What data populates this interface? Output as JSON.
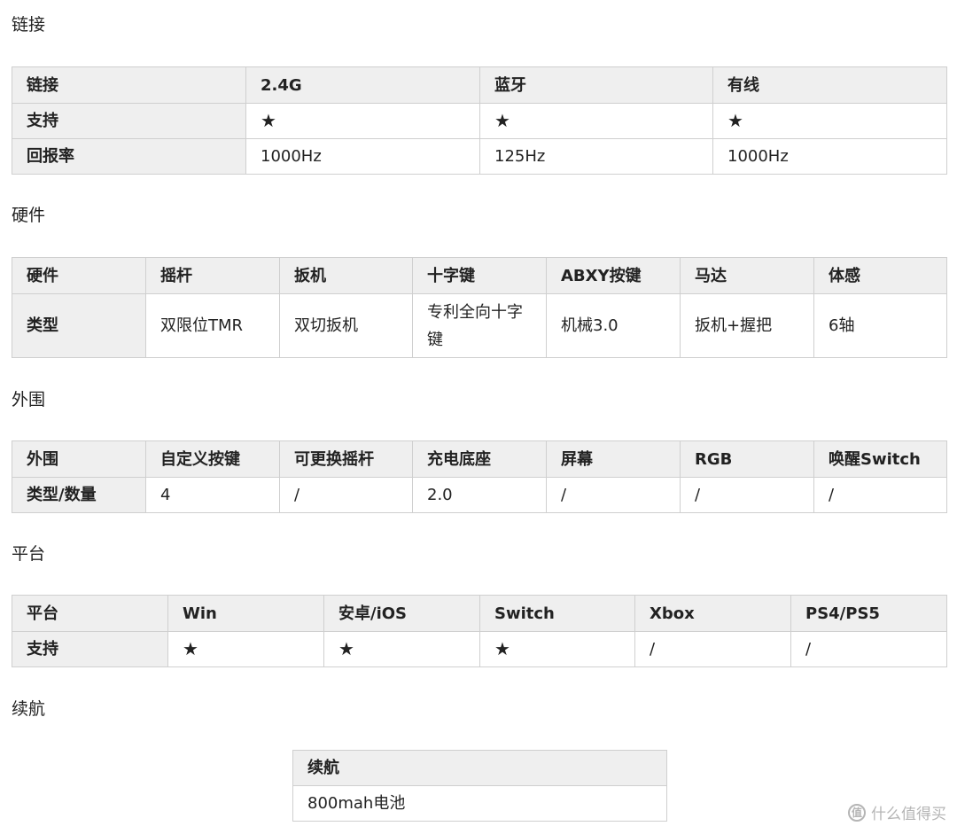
{
  "sections": {
    "link": {
      "title": "链接",
      "header": [
        "链接",
        "2.4G",
        "蓝牙",
        "有线"
      ],
      "rows": [
        [
          "支持",
          "★",
          "★",
          "★"
        ],
        [
          "回报率",
          "1000Hz",
          "125Hz",
          "1000Hz"
        ]
      ]
    },
    "hardware": {
      "title": "硬件",
      "header": [
        "硬件",
        "摇杆",
        "扳机",
        "十字键",
        "ABXY按键",
        "马达",
        "体感"
      ],
      "rows": [
        [
          "类型",
          "双限位TMR",
          "双切扳机",
          "专利全向十字键",
          "机械3.0",
          "扳机+握把",
          "6轴"
        ]
      ]
    },
    "peripheral": {
      "title": "外围",
      "header": [
        "外围",
        "自定义按键",
        "可更换摇杆",
        "充电底座",
        "屏幕",
        "RGB",
        "唤醒Switch"
      ],
      "rows": [
        [
          "类型/数量",
          "4",
          "/",
          "2.0",
          "/",
          "/",
          "/"
        ]
      ]
    },
    "platform": {
      "title": "平台",
      "header": [
        "平台",
        "Win",
        "安卓/iOS",
        "Switch",
        "Xbox",
        "PS4/PS5"
      ],
      "rows": [
        [
          "支持",
          "★",
          "★",
          "★",
          "/",
          "/"
        ]
      ]
    },
    "battery": {
      "title": "续航",
      "header": [
        "续航"
      ],
      "rows": [
        [
          "800mah电池"
        ]
      ]
    }
  },
  "watermark": {
    "logo_text": "值",
    "text": "什么值得买"
  }
}
